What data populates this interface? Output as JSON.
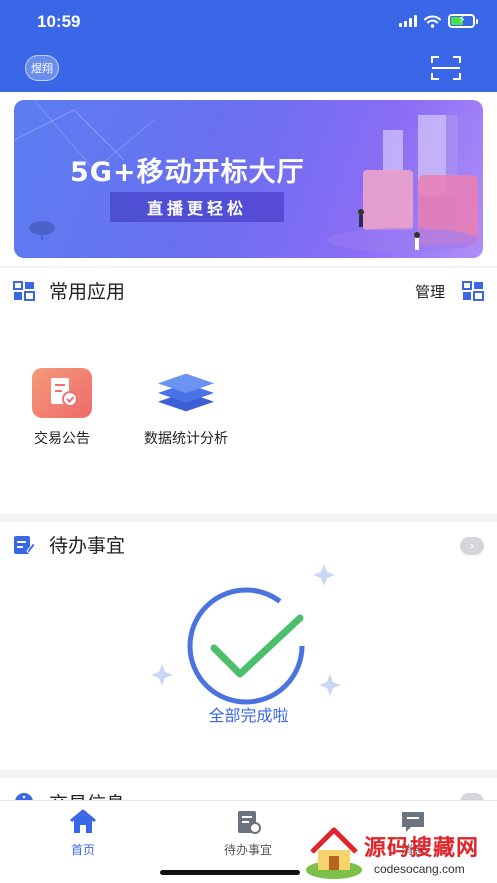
{
  "status_bar": {
    "time": "10:59"
  },
  "header": {
    "user_badge": "煜翔",
    "scan_icon": "scan-icon"
  },
  "banner": {
    "title": "5G+移动开标大厅",
    "subtitle": "直播更轻松"
  },
  "common_apps": {
    "title": "常用应用",
    "manage_label": "管理",
    "items": [
      {
        "label": "交易公告",
        "icon": "announcement-icon"
      },
      {
        "label": "数据统计分析",
        "icon": "layers-icon"
      }
    ]
  },
  "todo": {
    "title": "待办事宜",
    "empty_text": "全部完成啦"
  },
  "trade_info": {
    "title": "交易信息"
  },
  "tabbar": {
    "items": [
      {
        "label": "首页",
        "icon": "home-icon",
        "active": true
      },
      {
        "label": "待办事宜",
        "icon": "todo-icon",
        "active": false
      },
      {
        "label": "消息",
        "icon": "message-icon",
        "active": false
      }
    ]
  },
  "watermark": {
    "title": "源码搜藏网",
    "url": "codesocang.com"
  },
  "colors": {
    "primary": "#3a67e8",
    "success": "#4cbf6a",
    "watermark_red": "#e0242a"
  }
}
